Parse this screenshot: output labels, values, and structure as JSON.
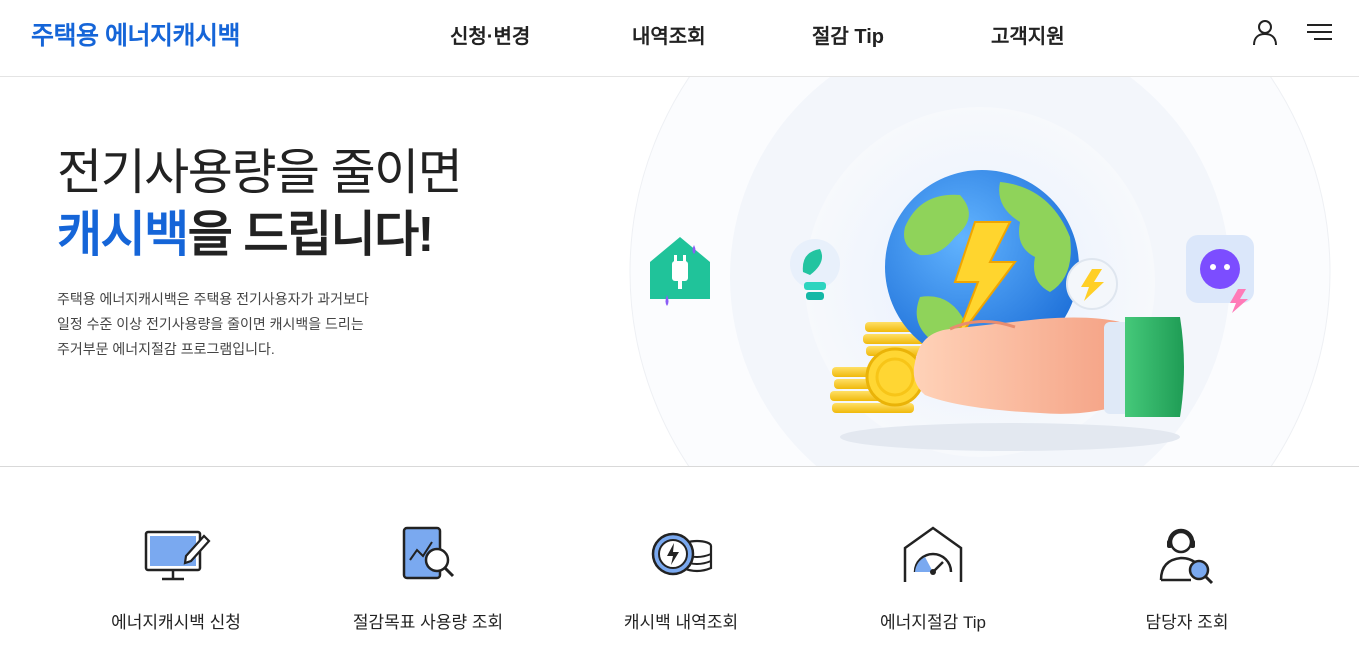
{
  "header": {
    "logo": "주택용 에너지캐시백",
    "nav": [
      "신청·변경",
      "내역조회",
      "절감 Tip",
      "고객지원"
    ],
    "user_icon": "user-icon",
    "menu_icon": "hamburger-menu-icon"
  },
  "hero": {
    "headline_line1": "전기사용량을 줄이면",
    "headline_accent": "캐시백",
    "headline_line2_rest": "을 드립니다!",
    "description": [
      "주택용 에너지캐시백은 주택용 전기사용자가 과거보다",
      "일정 수준 이상 전기사용량을 줄이면 캐시백을 드리는",
      "주거부문 에너지절감 프로그램입니다."
    ],
    "illustration": "hand-holding-globe-with-lightning-and-coins"
  },
  "quick_menu": [
    {
      "label": "에너지캐시백 신청",
      "icon": "monitor-pen-icon"
    },
    {
      "label": "절감목표 사용량 조회",
      "icon": "document-chart-search-icon"
    },
    {
      "label": "캐시백 내역조회",
      "icon": "lightning-coins-icon"
    },
    {
      "label": "에너지절감 Tip",
      "icon": "house-gauge-icon"
    },
    {
      "label": "담당자 조회",
      "icon": "agent-search-icon"
    }
  ],
  "colors": {
    "brand": "#1565d8",
    "text": "#222222",
    "icon_fill": "#6fa2ee"
  }
}
